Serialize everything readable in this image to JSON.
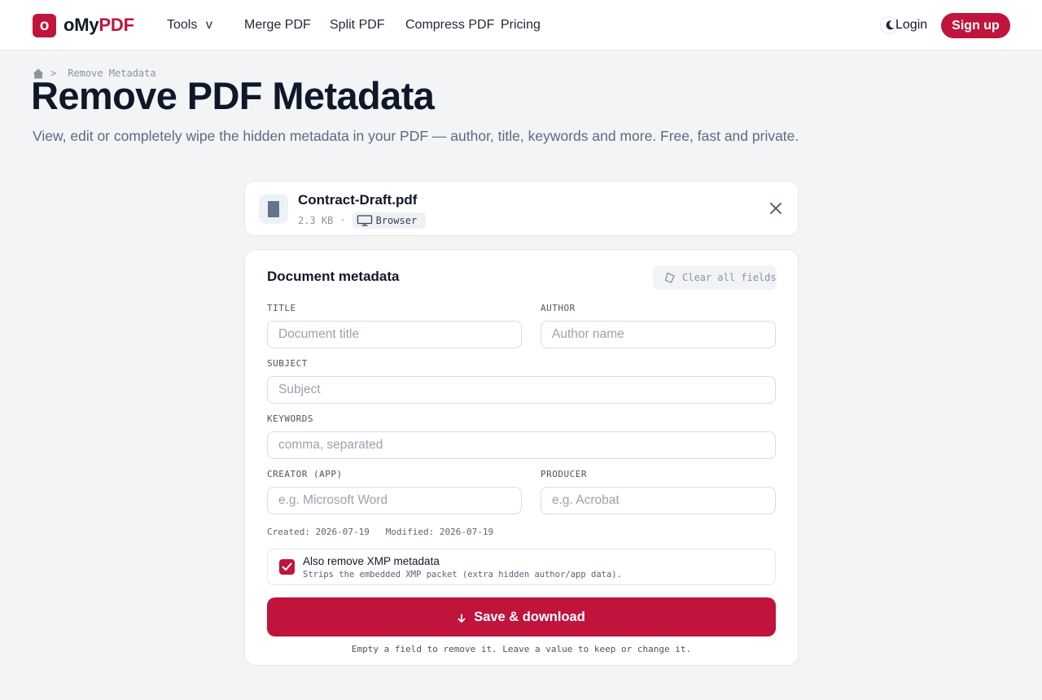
{
  "brand": {
    "logo_letter": "o",
    "name_prefix": "oMy",
    "name_accent": "PDF",
    "accent_color": "#c0143c"
  },
  "nav": {
    "tools": "Tools",
    "tools_caret": "v",
    "merge": "Merge PDF",
    "split": "Split PDF",
    "compress": "Compress PDF",
    "pricing": "Pricing"
  },
  "header": {
    "theme_icon": "moon-icon",
    "login": "Login",
    "signup": "Sign up"
  },
  "breadcrumb": {
    "home_icon": "home-icon",
    "separator": ">",
    "current": "Remove Metadata"
  },
  "hero": {
    "title": "Remove PDF Metadata",
    "subtitle": "View, edit or completely wipe the hidden metadata in your PDF — author, title, keywords and more. Free, fast and private."
  },
  "file": {
    "name": "Contract-Draft.pdf",
    "size": "2.3 KB",
    "dot": "·",
    "source": "Browser",
    "source_icon": "monitor-icon",
    "close_icon": "close-icon"
  },
  "metadata": {
    "heading": "Document metadata",
    "clear_label": "Clear all fields",
    "clear_icon": "eraser-icon",
    "fields": {
      "title": {
        "label": "TITLE",
        "placeholder": "Document title",
        "value": ""
      },
      "author": {
        "label": "AUTHOR",
        "placeholder": "Author name",
        "value": ""
      },
      "subject": {
        "label": "SUBJECT",
        "placeholder": "Subject",
        "value": ""
      },
      "keywords": {
        "label": "KEYWORDS",
        "placeholder": "comma, separated",
        "value": ""
      },
      "creator": {
        "label": "CREATOR (APP)",
        "placeholder": "e.g. Microsoft Word",
        "value": ""
      },
      "producer": {
        "label": "PRODUCER",
        "placeholder": "e.g. Acrobat",
        "value": ""
      }
    },
    "dates": "Created: 2026-07-19   Modified: 2026-07-19",
    "xmp": {
      "checked": true,
      "title": "Also remove XMP metadata",
      "description": "Strips the embedded XMP packet (extra hidden author/app data)."
    },
    "save_label": "Save & download",
    "save_icon": "download-arrow-icon",
    "footnote": "Empty a field to remove it. Leave a value to keep or change it."
  }
}
